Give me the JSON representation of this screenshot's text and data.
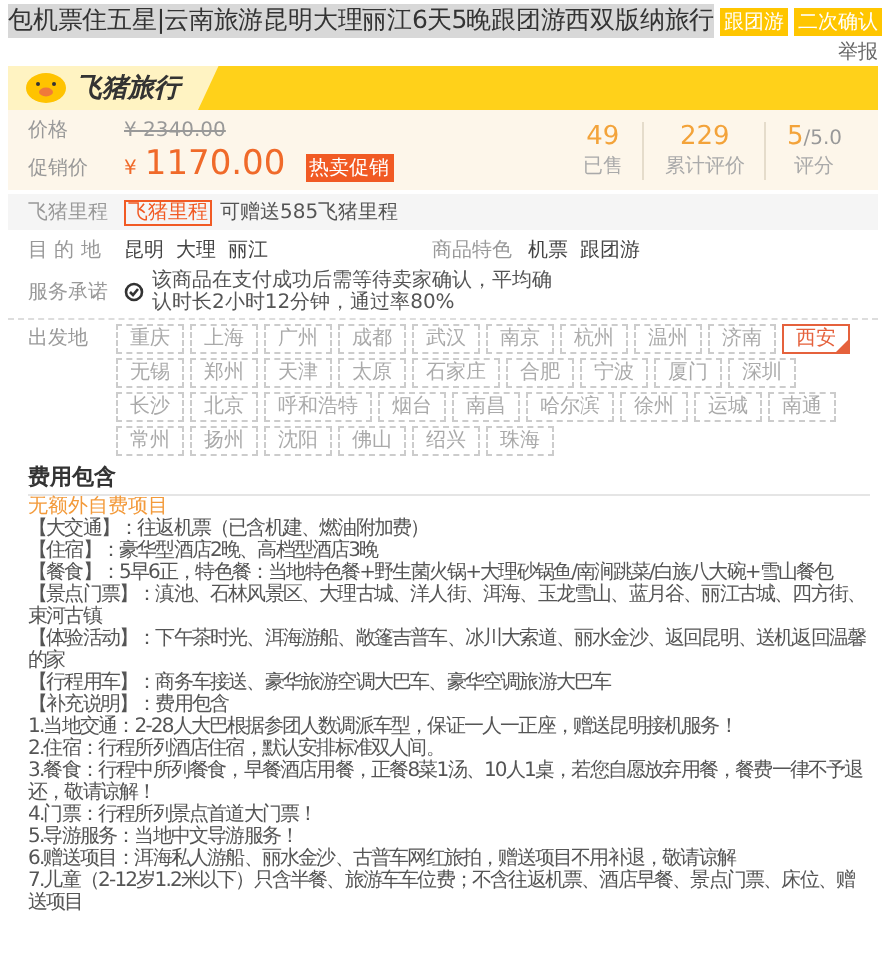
{
  "title": "包机票住五星|云南旅游昆明大理丽江6天5晚跟团游西双版纳旅行",
  "title_tags": [
    "跟团游",
    "二次确认"
  ],
  "report_link": "举报",
  "brand": {
    "name": "飞猪旅行"
  },
  "price": {
    "label": "价格",
    "original": "¥ 2340.00",
    "promo_label": "促销价",
    "currency": "¥",
    "promo": "1170.00",
    "promo_tag": "热卖促销"
  },
  "stats": [
    {
      "value": "49",
      "label": "已售"
    },
    {
      "value": "229",
      "label": "累计评价"
    },
    {
      "value": "5",
      "suffix": "/5.0",
      "label": "评分"
    }
  ],
  "mileage": {
    "label": "飞猪里程",
    "tag": "飞猪里程",
    "text": "可赠送585飞猪里程"
  },
  "destination": {
    "label": "目 的 地",
    "items": [
      "昆明",
      "大理",
      "丽江"
    ]
  },
  "features": {
    "label": "商品特色",
    "items": [
      "机票",
      "跟团游"
    ]
  },
  "service": {
    "label": "服务承诺",
    "text": "该商品在支付成功后需等待卖家确认，平均确认时长2小时12分钟，通过率80%"
  },
  "departure": {
    "label": "出发地",
    "cities": [
      {
        "name": "重庆",
        "selected": false
      },
      {
        "name": "上海",
        "selected": false
      },
      {
        "name": "广州",
        "selected": false
      },
      {
        "name": "成都",
        "selected": false
      },
      {
        "name": "武汉",
        "selected": false
      },
      {
        "name": "南京",
        "selected": false
      },
      {
        "name": "杭州",
        "selected": false
      },
      {
        "name": "温州",
        "selected": false
      },
      {
        "name": "济南",
        "selected": false
      },
      {
        "name": "西安",
        "selected": true
      },
      {
        "name": "无锡",
        "selected": false
      },
      {
        "name": "郑州",
        "selected": false
      },
      {
        "name": "天津",
        "selected": false
      },
      {
        "name": "太原",
        "selected": false
      },
      {
        "name": "石家庄",
        "selected": false
      },
      {
        "name": "合肥",
        "selected": false
      },
      {
        "name": "宁波",
        "selected": false
      },
      {
        "name": "厦门",
        "selected": false
      },
      {
        "name": "深圳",
        "selected": false
      },
      {
        "name": "长沙",
        "selected": false
      },
      {
        "name": "北京",
        "selected": false
      },
      {
        "name": "呼和浩特",
        "selected": false
      },
      {
        "name": "烟台",
        "selected": false
      },
      {
        "name": "南昌",
        "selected": false
      },
      {
        "name": "哈尔滨",
        "selected": false
      },
      {
        "name": "徐州",
        "selected": false
      },
      {
        "name": "运城",
        "selected": false
      },
      {
        "name": "南通",
        "selected": false
      },
      {
        "name": "常州",
        "selected": false
      },
      {
        "name": "扬州",
        "selected": false
      },
      {
        "name": "沈阳",
        "selected": false
      },
      {
        "name": "佛山",
        "selected": false
      },
      {
        "name": "绍兴",
        "selected": false
      },
      {
        "name": "珠海",
        "selected": false
      }
    ]
  },
  "fees": {
    "heading": "费用包含",
    "note": "无额外自费项目",
    "lines": [
      "【大交通】：往返机票（已含机建、燃油附加费）",
      "【住宿】：豪华型酒店2晚、高档型酒店3晚",
      "【餐食】：5早6正，特色餐：当地特色餐+野生菌火锅+大理砂锅鱼/南涧跳菜/白族八大碗+雪山餐包",
      "【景点门票】：滇池、石林风景区、大理古城、洋人街、洱海、玉龙雪山、蓝月谷、丽江古城、四方街、束河古镇",
      "【体验活动】：下午茶时光、洱海游船、敞篷吉普车、冰川大索道、丽水金沙、返回昆明、送机返回温馨的家",
      "【行程用车】：商务车接送、豪华旅游空调大巴车、豪华空调旅游大巴车",
      "【补充说明】：费用包含",
      "1.当地交通：2-28人大巴根据参团人数调派车型，保证一人一正座，赠送昆明接机服务！",
      "2.住宿：行程所列酒店住宿，默认安排标准双人间。",
      "3.餐食：行程中所列餐食，早餐酒店用餐，正餐8菜1汤、10人1桌，若您自愿放弃用餐，餐费一律不予退还，敬请谅解！",
      "4.门票：行程所列景点首道大门票！",
      "5.导游服务：当地中文导游服务！",
      "6.赠送项目：洱海私人游船、丽水金沙、古普车网红旅拍，赠送项目不用补退，敬请谅解",
      "7.儿童（2-12岁1.2米以下）只含半餐、旅游车车位费；不含往返机票、酒店早餐、景点门票、床位、赠送项目"
    ]
  }
}
